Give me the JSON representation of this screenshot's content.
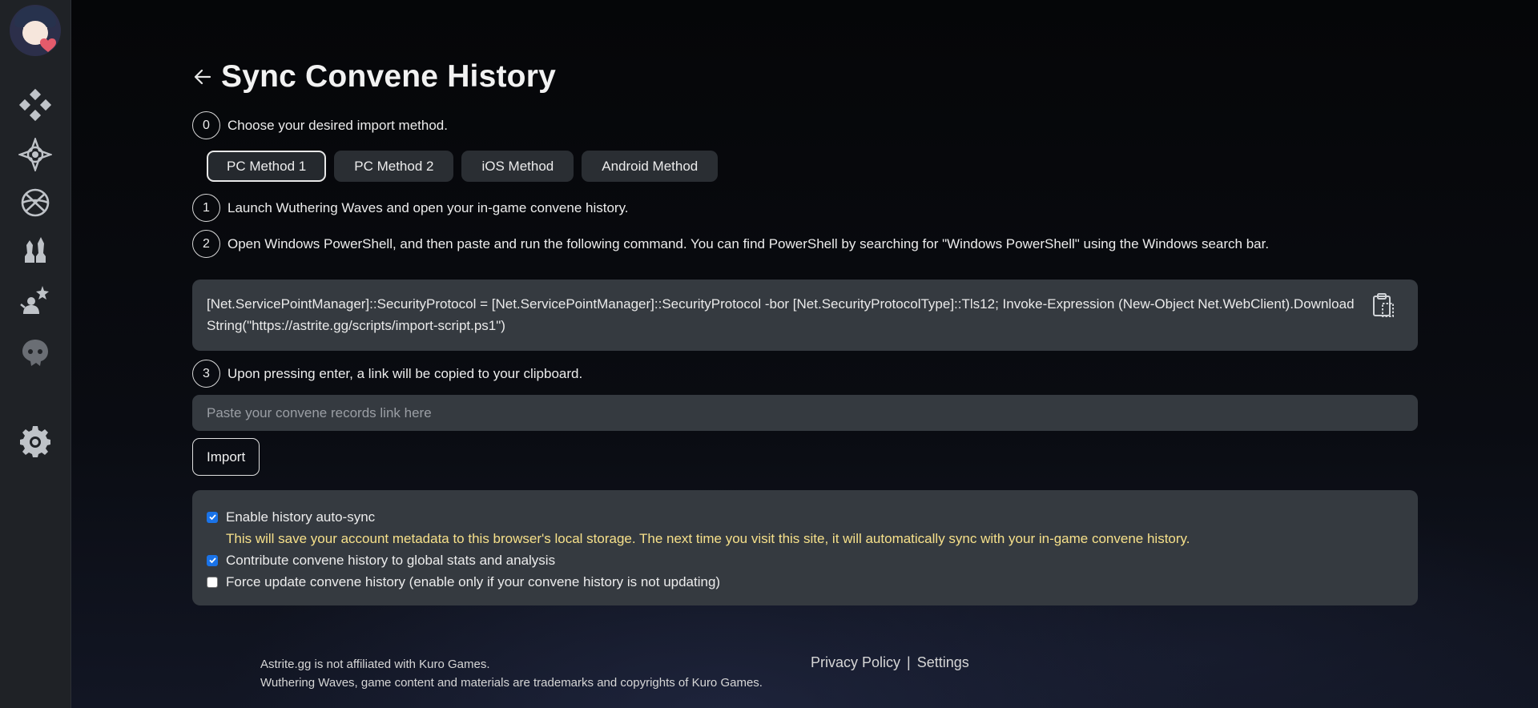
{
  "sidebar": {
    "avatar": "avatar",
    "items": [
      {
        "icon": "dashboard-icon"
      },
      {
        "icon": "convene-icon"
      },
      {
        "icon": "globe-icon"
      },
      {
        "icon": "characters-icon"
      },
      {
        "icon": "tierlist-icon"
      },
      {
        "icon": "echo-icon"
      }
    ],
    "settings_icon": "gear-icon"
  },
  "page": {
    "title": "Sync Convene History"
  },
  "steps": {
    "s0": {
      "num": "0",
      "text": "Choose your desired import method."
    },
    "s1": {
      "num": "1",
      "text": "Launch Wuthering Waves and open your in-game convene history."
    },
    "s2": {
      "num": "2",
      "text": "Open Windows PowerShell, and then paste and run the following command. You can find PowerShell by searching for \"Windows PowerShell\" using the Windows search bar."
    },
    "s3": {
      "num": "3",
      "text": "Upon pressing enter, a link will be copied to your clipboard."
    }
  },
  "methods": [
    {
      "label": "PC Method 1",
      "active": true
    },
    {
      "label": "PC Method 2",
      "active": false
    },
    {
      "label": "iOS Method",
      "active": false
    },
    {
      "label": "Android Method",
      "active": false
    }
  ],
  "command": "[Net.ServicePointManager]::SecurityProtocol = [Net.ServicePointManager]::SecurityProtocol -bor [Net.SecurityProtocolType]::Tls12; Invoke-Expression (New-Object Net.WebClient).DownloadString(\"https://astrite.gg/scripts/import-script.ps1\")",
  "link_input": {
    "placeholder": "Paste your convene records link here",
    "value": ""
  },
  "import_label": "Import",
  "options": {
    "auto_sync": {
      "label": "Enable history auto-sync",
      "checked": true
    },
    "auto_sync_note": "This will save your account metadata to this browser's local storage. The next time you visit this site, it will automatically sync with your in-game convene history.",
    "contribute": {
      "label": "Contribute convene history to global stats and analysis",
      "checked": true
    },
    "force_update": {
      "label": "Force update convene history (enable only if your convene history is not updating)",
      "checked": false
    }
  },
  "footer": {
    "line1": "Astrite.gg is not affiliated with Kuro Games.",
    "line2": "Wuthering Waves, game content and materials are trademarks and copyrights of Kuro Games.",
    "privacy": "Privacy Policy",
    "separator": "|",
    "settings": "Settings"
  },
  "colors": {
    "sidebar_bg": "#1f2226",
    "panel_bg": "#353a40",
    "note_text": "#f6e08a",
    "checkbox_accent": "#1a73e8"
  }
}
